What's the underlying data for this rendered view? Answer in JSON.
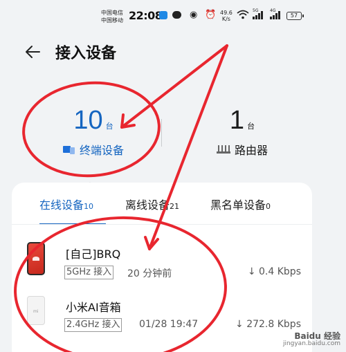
{
  "status_bar": {
    "carrier_1": "中国电信",
    "carrier_2": "中国移动",
    "time": "22:08",
    "net_speed_value": "49.6",
    "net_speed_unit": "K/s",
    "sim1_label": "5G",
    "sim2_label": "4G",
    "battery": "57"
  },
  "header": {
    "title": "接入设备"
  },
  "summary": {
    "terminal_count": "10",
    "terminal_unit": "台",
    "terminal_label": "终端设备",
    "router_count": "1",
    "router_unit": "台",
    "router_label": "路由器"
  },
  "tabs": [
    {
      "label": "在线设备",
      "count": "10",
      "active": true
    },
    {
      "label": "离线设备",
      "count": "21",
      "active": false
    },
    {
      "label": "黑名单设备",
      "count": "0",
      "active": false
    }
  ],
  "devices": [
    {
      "name": "[自己]BRQ",
      "band": "5GHz 接入",
      "time": "20 分钟前",
      "speed": "↓ 0.4 Kbps",
      "icon": "huawei-phone-icon"
    },
    {
      "name": "小米AI音箱",
      "band": "2.4GHz 接入",
      "time": "01/28 19:47",
      "speed": "↓ 272.8 Kbps",
      "icon": "mi-speaker-icon"
    }
  ],
  "watermark": {
    "brand": "Baidu 经验",
    "url": "jingyan.baidu.com"
  },
  "colors": {
    "accent": "#1565c0",
    "annotation": "#e8262f"
  }
}
